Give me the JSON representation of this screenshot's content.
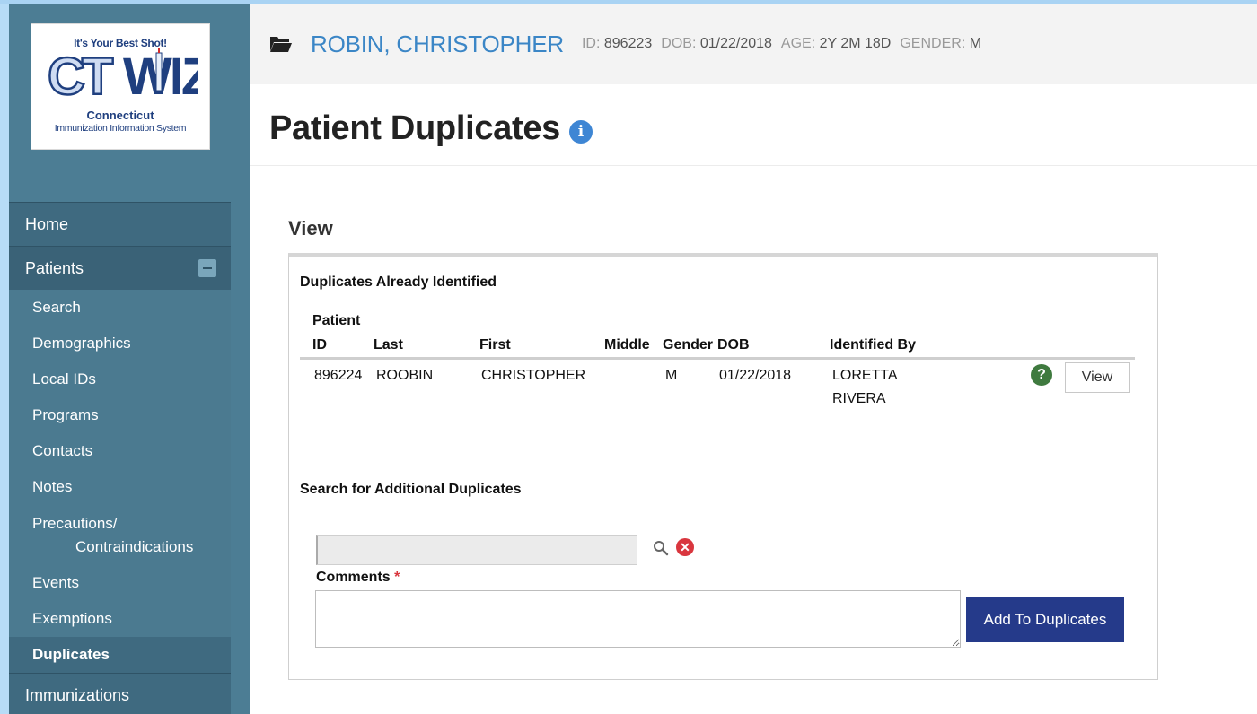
{
  "logo": {
    "tagline": "It's Your Best Shot!",
    "name": "Connecticut",
    "subtitle": "Immunization Information System",
    "wordmark": "CT WIZ"
  },
  "nav": {
    "home": "Home",
    "patients": "Patients",
    "sub_items": [
      "Search",
      "Demographics",
      "Local IDs",
      "Programs",
      "Contacts",
      "Notes"
    ],
    "precautions_line1": "Precautions/",
    "precautions_line2": "Contraindications",
    "sub_items_after": [
      "Events",
      "Exemptions"
    ],
    "active_item": "Duplicates",
    "immunizations": "Immunizations"
  },
  "patient": {
    "name": "ROBIN, CHRISTOPHER",
    "id_label": "ID:",
    "id": "896223",
    "dob_label": "DOB:",
    "dob": "01/22/2018",
    "age_label": "AGE:",
    "age": "2Y 2M 18D",
    "gender_label": "GENDER:",
    "gender": "M"
  },
  "page": {
    "title": "Patient Duplicates",
    "section": "View"
  },
  "duplicates": {
    "heading": "Duplicates Already Identified",
    "header_patient": "Patient",
    "columns": [
      "ID",
      "Last",
      "First",
      "Middle",
      "Gender",
      "DOB",
      "Identified By"
    ],
    "rows": [
      {
        "id": "896224",
        "last": "ROOBIN",
        "first": "CHRISTOPHER",
        "middle": "",
        "gender": "M",
        "dob": "01/22/2018",
        "identified_by_line1": "LORETTA",
        "identified_by_line2": "RIVERA",
        "view_label": "View"
      }
    ]
  },
  "search": {
    "heading": "Search for Additional Duplicates",
    "input_value": "",
    "comments_label": "Comments",
    "required_mark": "*",
    "add_button": "Add To Duplicates"
  },
  "colors": {
    "sidebar": "#4c7d94",
    "accent_name": "#3b86c6",
    "primary_button": "#253a8a"
  }
}
